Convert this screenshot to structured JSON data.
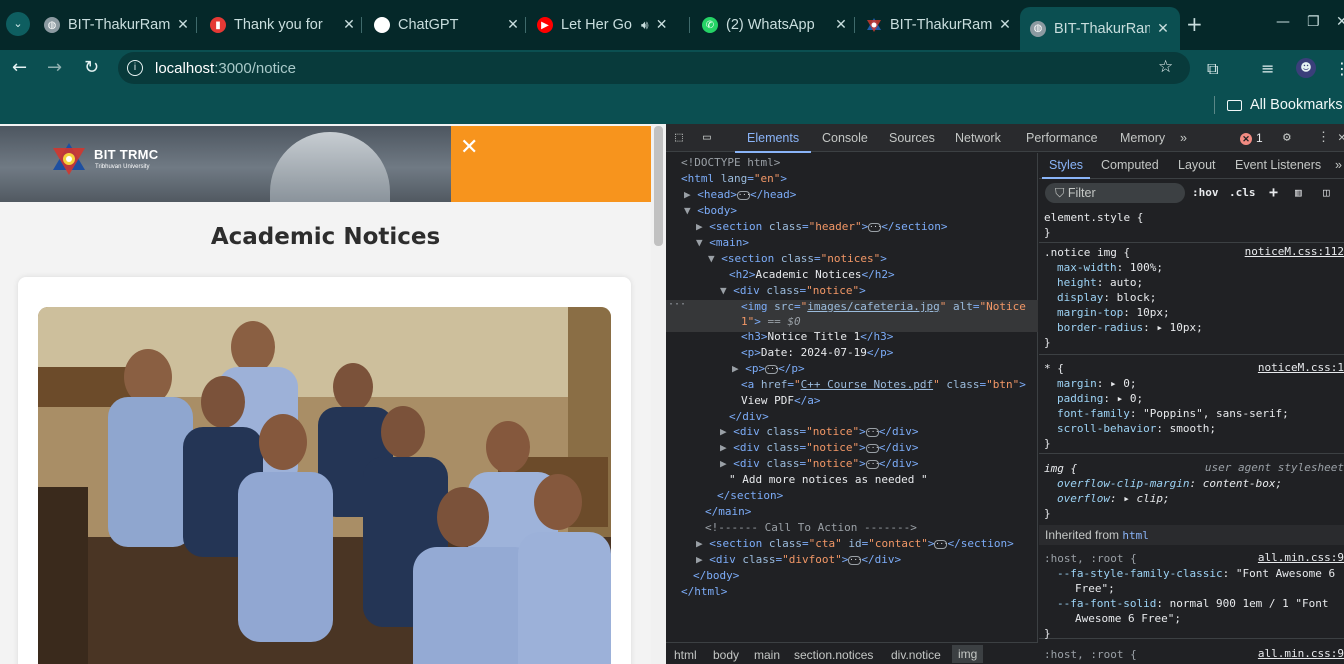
{
  "browser": {
    "tabs": [
      {
        "title": "BIT-ThakurRam",
        "icon": "globe-icon"
      },
      {
        "title": "Thank you for",
        "icon": "lock-red-icon"
      },
      {
        "title": "ChatGPT",
        "icon": "chatgpt-icon"
      },
      {
        "title": "Let Her Go",
        "icon": "youtube-icon",
        "audio": "speaker-icon"
      },
      {
        "title": "(2) WhatsApp",
        "icon": "whatsapp-icon"
      },
      {
        "title": "BIT-ThakurRam",
        "icon": "bit-logo-icon"
      },
      {
        "title": "BIT-ThakurRam",
        "icon": "globe-icon",
        "active": true
      }
    ],
    "address": {
      "host": "localhost",
      "path": ":3000/notice"
    },
    "bookmarks_label": "All Bookmarks"
  },
  "page": {
    "brand": "BIT TRMC",
    "brand_sub": "Tribhuvan University",
    "close_symbol": "✕",
    "heading": "Academic Notices",
    "accent_color": "#f7941d"
  },
  "devtools": {
    "tabs": [
      "Elements",
      "Console",
      "Sources",
      "Network",
      "Performance",
      "Memory"
    ],
    "active_tab": "Elements",
    "more_tabs": "»",
    "error_count": "1",
    "dom_lines": [
      "<!DOCTYPE html>",
      "<html lang=\"en\">",
      "<head>",
      "</head>",
      "<body>",
      "<section class=\"header\">",
      "</section>",
      "<main>",
      "<section class=\"notices\">",
      "<h2>Academic Notices</h2>",
      "<div class=\"notice\">",
      "<img src=\"images/cafeteria.jpg\" alt=\"Notice 1\"> == $0",
      "<h3>Notice Title 1</h3>",
      "<p>Date: 2024-07-19</p>",
      "<p>",
      "</p>",
      "<a href=\"C++ Course Notes.pdf\" class=\"btn\">",
      "View PDF</a>",
      "</div>",
      "<div class=\"notice\">",
      "</div>",
      "\" Add more notices as needed \"",
      "</section>",
      "</main>",
      "<!------ Call To Action ------->",
      "<section class=\"cta\" id=\"contact\">",
      "<div class=\"divfoot\">",
      "</body>",
      "</html>"
    ],
    "breadcrumbs": [
      "html",
      "body",
      "main",
      "section.notices",
      "div.notice",
      "img"
    ],
    "styles_tabs": [
      "Styles",
      "Computed",
      "Layout",
      "Event Listeners"
    ],
    "filter_placeholder": "Filter",
    "filter_buttons": [
      ":hov",
      ".cls",
      "+"
    ],
    "rules": {
      "element_style": "element.style {",
      "notice_img": {
        "selector": ".notice img {",
        "source": "noticeM.css:112",
        "props": [
          [
            "max-width",
            "100%;"
          ],
          [
            "height",
            "auto;"
          ],
          [
            "display",
            "block;"
          ],
          [
            "margin-top",
            "10px;"
          ],
          [
            "border-radius",
            "10px;"
          ]
        ]
      },
      "universal": {
        "selector": "* {",
        "source": "noticeM.css:1",
        "props": [
          [
            "margin",
            "0;"
          ],
          [
            "padding",
            "0;"
          ],
          [
            "font-family",
            "\"Poppins\", sans-serif;"
          ],
          [
            "scroll-behavior",
            "smooth;"
          ]
        ]
      },
      "img_ua": {
        "selector": "img {",
        "source": "user agent stylesheet",
        "props": [
          [
            "overflow-clip-margin",
            "content-box;"
          ],
          [
            "overflow",
            "clip;"
          ]
        ]
      },
      "inherited_label": "Inherited from",
      "inherited_tag": "html",
      "host_root": {
        "selector": ":host, :root {",
        "source": "all.min.css:9",
        "props": [
          [
            "--fa-style-family-classic",
            "\"Font Awesome 6"
          ],
          [
            "",
            "Free\";"
          ],
          [
            "--fa-font-solid",
            "normal 900 1em / 1 \"Font"
          ],
          [
            "",
            "Awesome 6 Free\";"
          ]
        ]
      },
      "host_root2": {
        "selector": ":host, :root {",
        "source": "all.min.css:9"
      }
    }
  }
}
